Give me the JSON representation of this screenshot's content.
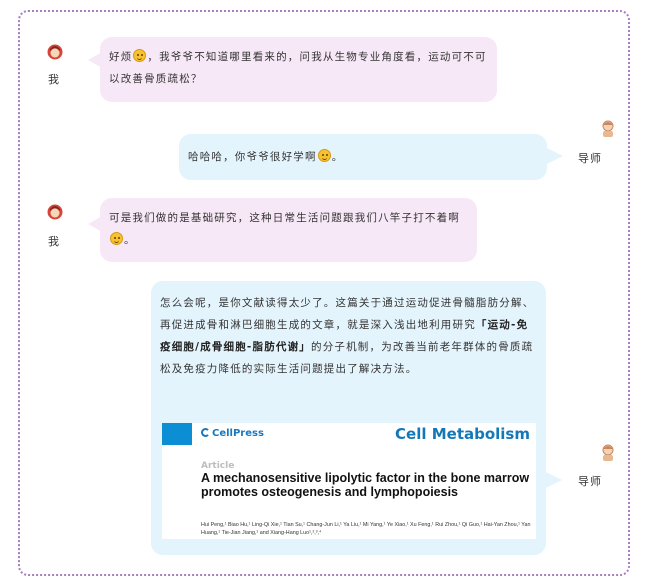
{
  "messages": [
    {
      "sender": "我",
      "text": [
        "好烦",
        "，我爷爷不知道哪里看来的，问我从生物专业角度看，运动可不可以改善骨质疏松？"
      ],
      "emoji": "confused-emoji"
    },
    {
      "sender": "导师",
      "text": [
        "哈哈哈，你爷爷很好学啊",
        "。"
      ],
      "emoji": "smile-emoji"
    },
    {
      "sender": "我",
      "text": [
        "可是我们做的是基础研究，这种日常生活问题跟我们八竿子打不着啊",
        "。"
      ],
      "emoji": "awkward-emoji"
    },
    {
      "sender": "导师",
      "text_before": "怎么会呢，是你文献读得太少了。这篇关于通过运动促进骨髓脂肪分解、再促进成骨和淋巴细胞生成的文章，就是深入浅出地利用研究",
      "highlight": "「运动-免疫细胞/成骨细胞-脂肪代谢」",
      "text_after": "的分子机制，为改善当前老年群体的骨质疏松及免疫力降低的实际生活问题提出了解决方法。"
    }
  ],
  "paper": {
    "publisher": "CellPress",
    "journal": "Cell Metabolism",
    "type": "Article",
    "title": "A mechanosensitive lipolytic factor in the bone marrow promotes osteogenesis and lymphopoiesis",
    "authors": "Hui Peng,¹ Biao Hu,¹ Ling-Qi Xie,¹ Tian Su,¹ Chang-Jun Li,¹ Ya Liu,¹ Mi Yang,¹ Ye Xiao,¹ Xu Feng,¹ Rui Zhou,¹ Qi Guo,¹ Hai-Yan Zhou,¹ Yan Huang,¹ Tie-Jian Jiang,¹ and Xiang-Hang Luo¹,²,³,⁴"
  },
  "colors": {
    "frame": "#a77fc0",
    "student_bubble": "#f7e8f7",
    "tutor_bubble": "#e4f4fc",
    "journal_blue": "#1478b8"
  }
}
